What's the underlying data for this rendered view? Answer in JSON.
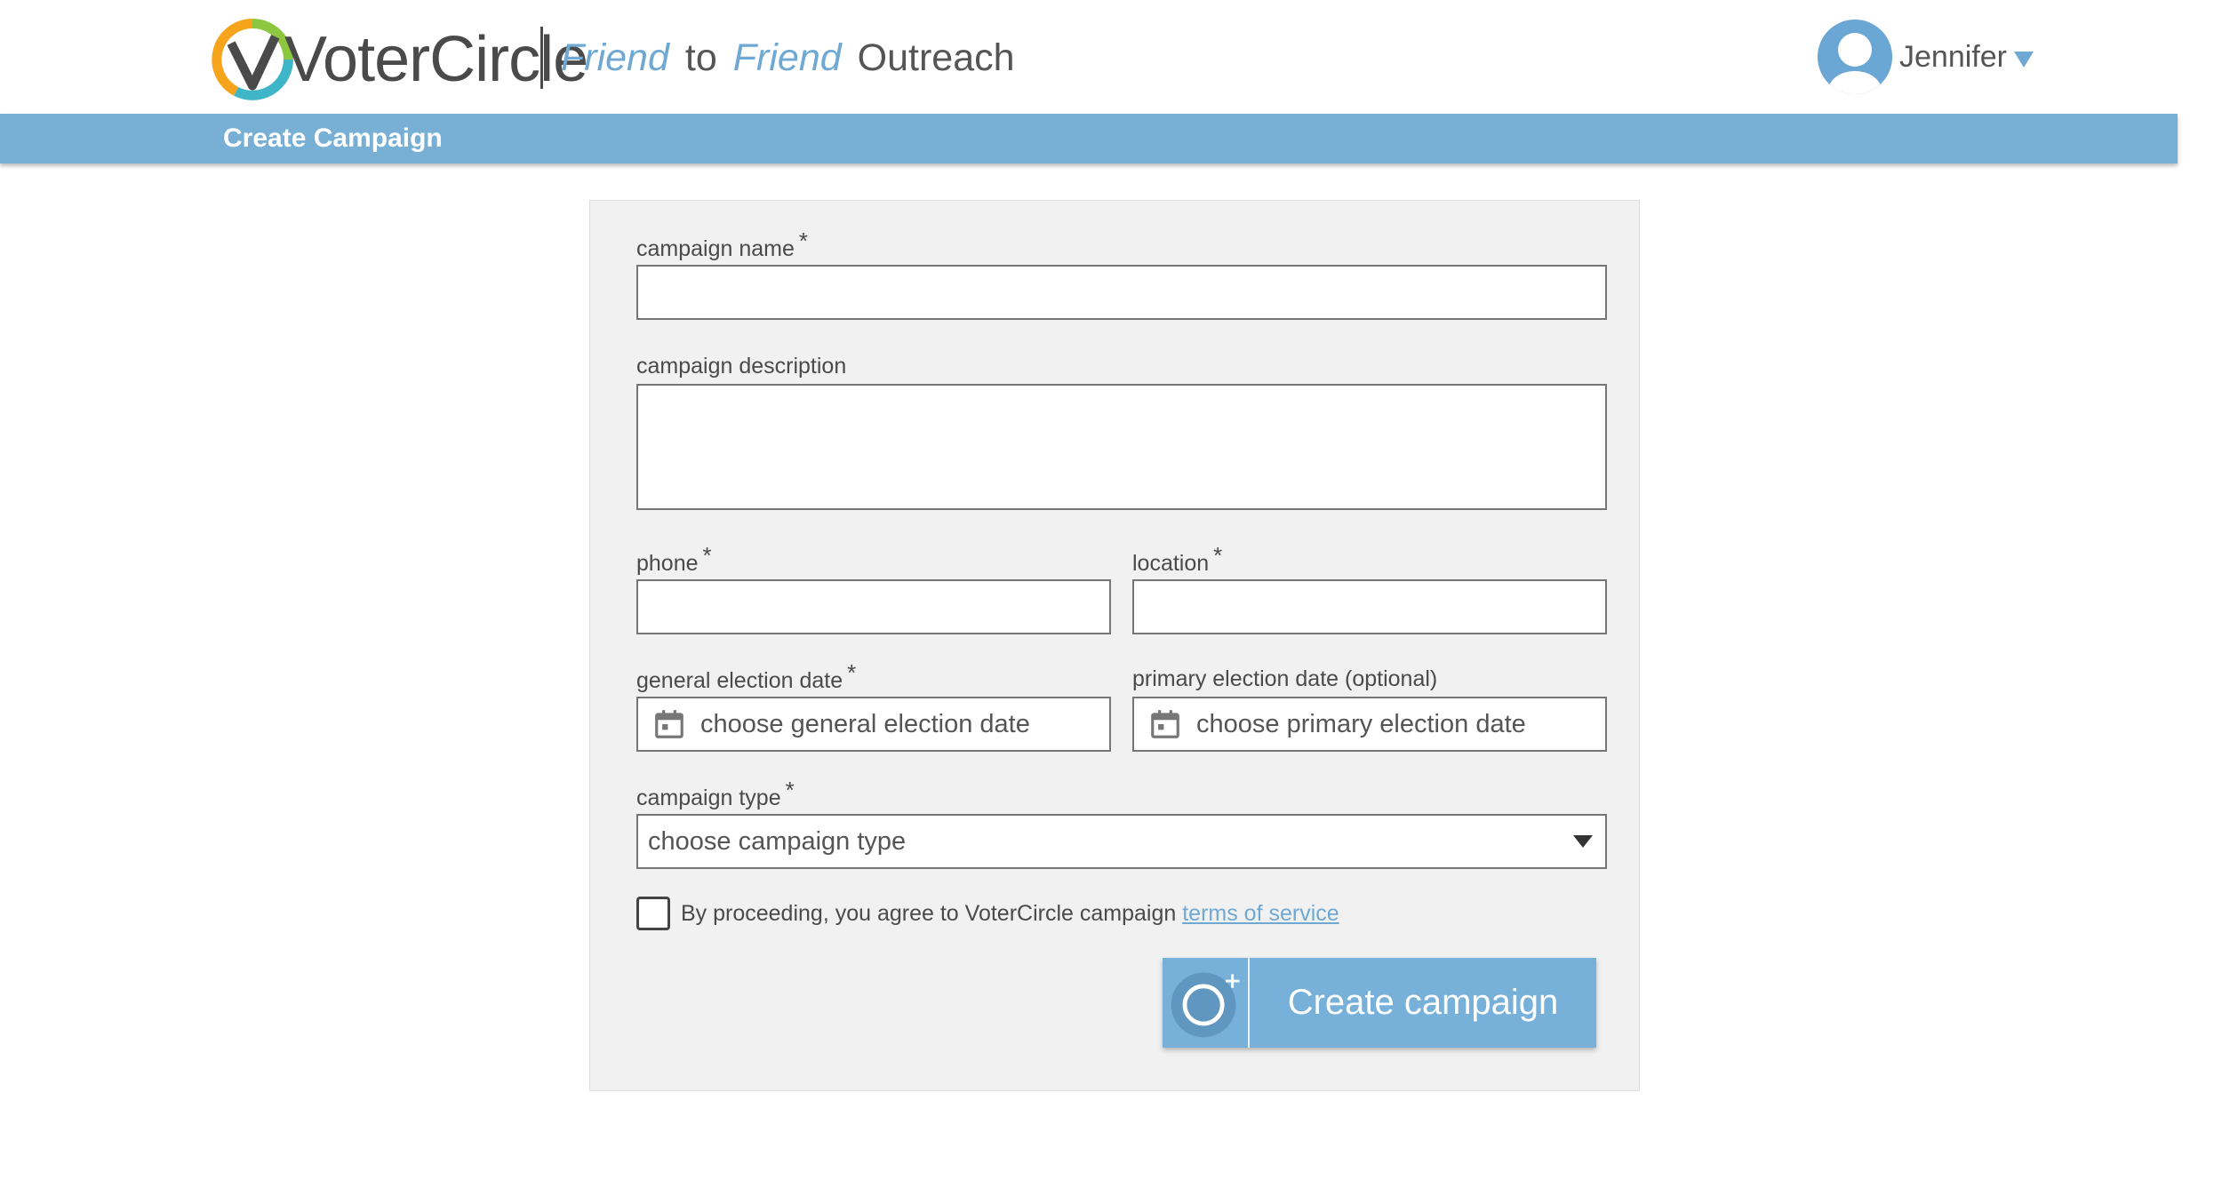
{
  "header": {
    "brand": "VoterCircle",
    "tagline": {
      "word1": "Friend",
      "word2": "to",
      "word3": "Friend",
      "word4": "Outreach"
    },
    "user_name": "Jennifer",
    "avatar_icon": "user-avatar-icon",
    "menu_icon": "caret-down-icon"
  },
  "subnav": {
    "title": "Create Campaign"
  },
  "form": {
    "campaign_name": {
      "label": "campaign name",
      "required": "*",
      "value": ""
    },
    "campaign_description": {
      "label": "campaign description",
      "value": ""
    },
    "phone": {
      "label": "phone",
      "required": "*",
      "value": ""
    },
    "location": {
      "label": "location",
      "required": "*",
      "value": ""
    },
    "general_election_date": {
      "label": "general election date",
      "required": "*",
      "placeholder": "choose general election date",
      "icon": "calendar-icon"
    },
    "primary_election_date": {
      "label": "primary election date (optional)",
      "placeholder": "choose primary election date",
      "icon": "calendar-icon"
    },
    "campaign_type": {
      "label": "campaign type",
      "required": "*",
      "selected": "choose campaign type",
      "icon": "dropdown-caret-icon"
    },
    "agreement": {
      "text": "By proceeding, you agree to VoterCircle campaign",
      "link": "terms of service",
      "checked": false
    },
    "submit": {
      "label": "Create campaign",
      "icon": "add-circle-icon"
    }
  },
  "colors": {
    "accent": "#77afd5",
    "link": "#6fa8d2",
    "logo_green": "#8dc63f",
    "logo_orange": "#f7a41d",
    "logo_teal": "#3fb6c8",
    "panel_bg": "#f1f1f1"
  }
}
